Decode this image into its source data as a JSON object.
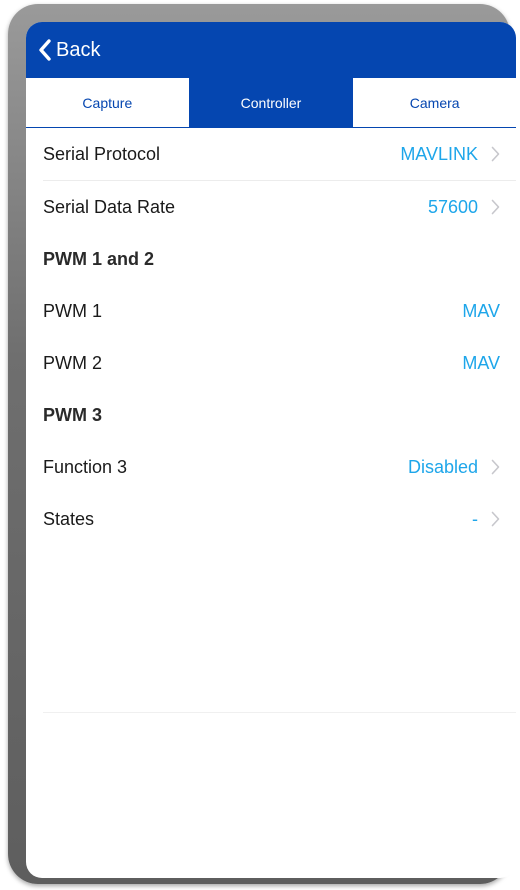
{
  "navbar": {
    "back_label": "Back"
  },
  "tabs": [
    {
      "label": "Capture",
      "active": false
    },
    {
      "label": "Controller",
      "active": true
    },
    {
      "label": "Camera",
      "active": false
    }
  ],
  "rows": {
    "serial_protocol": {
      "label": "Serial Protocol",
      "value": "MAVLINK"
    },
    "serial_data_rate": {
      "label": "Serial Data Rate",
      "value": "57600"
    },
    "pwm12_header": {
      "label": "PWM 1 and 2"
    },
    "pwm1": {
      "label": "PWM 1",
      "value": "MAV"
    },
    "pwm2": {
      "label": "PWM 2",
      "value": "MAV"
    },
    "pwm3_header": {
      "label": "PWM 3"
    },
    "function3": {
      "label": "Function 3",
      "value": "Disabled"
    },
    "states": {
      "label": "States",
      "value": "-"
    }
  },
  "colors": {
    "accent": "#0546b0",
    "value_text": "#1ea6ea",
    "chevron": "#c7c7cc"
  },
  "icons": {
    "back": "chevron-left-icon",
    "disclosure": "chevron-right-icon"
  }
}
